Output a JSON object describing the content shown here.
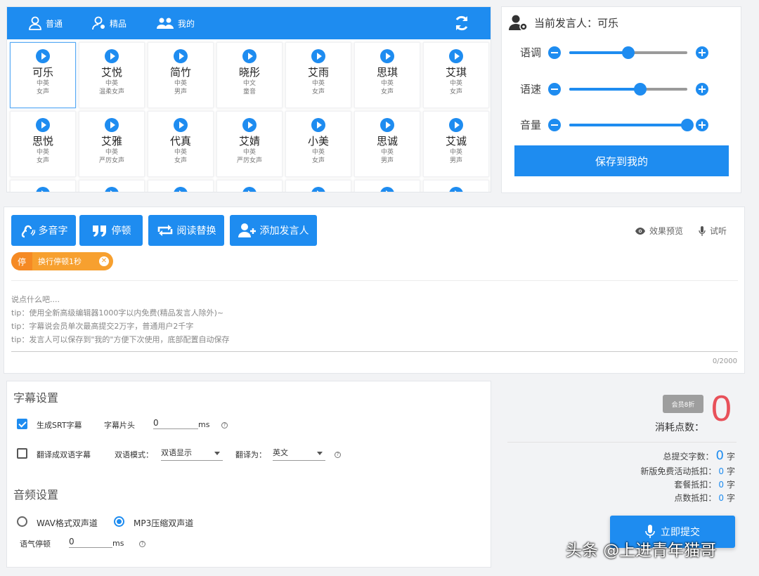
{
  "tabs": [
    {
      "label": "普通",
      "icon": "user-icon"
    },
    {
      "label": "精品",
      "icon": "user-award-icon"
    },
    {
      "label": "我的",
      "icon": "users-group-icon"
    }
  ],
  "voices": [
    {
      "name": "可乐",
      "lang": "中英",
      "type": "女声"
    },
    {
      "name": "艾悦",
      "lang": "中英",
      "type": "温柔女声"
    },
    {
      "name": "简竹",
      "lang": "中英",
      "type": "男声"
    },
    {
      "name": "晓彤",
      "lang": "中文",
      "type": "童音"
    },
    {
      "name": "艾雨",
      "lang": "中英",
      "type": "女声"
    },
    {
      "name": "思琪",
      "lang": "中英",
      "type": "女声"
    },
    {
      "name": "艾琪",
      "lang": "中英",
      "type": "女声"
    },
    {
      "name": "思悦",
      "lang": "中英",
      "type": "女声"
    },
    {
      "name": "艾雅",
      "lang": "中英",
      "type": "严厉女声"
    },
    {
      "name": "代真",
      "lang": "中英",
      "type": "女声"
    },
    {
      "name": "艾婧",
      "lang": "中英",
      "type": "严厉女声"
    },
    {
      "name": "小美",
      "lang": "中英",
      "type": "女声"
    },
    {
      "name": "思诚",
      "lang": "中英",
      "type": "男声"
    },
    {
      "name": "艾诚",
      "lang": "中英",
      "type": "男声"
    }
  ],
  "speaker": {
    "title": "当前发言人：可乐",
    "sliders": [
      {
        "label": "语调",
        "value": 0.5
      },
      {
        "label": "语速",
        "value": 0.6
      },
      {
        "label": "音量",
        "value": 1.0
      }
    ],
    "save_label": "保存到我的"
  },
  "editor": {
    "tools": [
      "多音字",
      "停顿",
      "阅读替换",
      "添加发言人"
    ],
    "preview_label": "效果预览",
    "listen_label": "试听",
    "pause_badge": "停",
    "pause_tag": "换行停顿1秒",
    "placeholder_lines": [
      "说点什么吧....",
      "tip：使用全新高级编辑器1000字以内免费(精品发言人除外)~",
      "tip：字幕说会员单次最高提交2万字，普通用户2千字",
      "tip：发言人可以保存到\"我的\"方便下次使用，底部配置自动保存"
    ],
    "counter": "0/2000"
  },
  "subtitles": {
    "title": "字幕设置",
    "srt_label": "生成SRT字幕",
    "head_label": "字幕片头",
    "head_value": "0",
    "ms": "ms",
    "bilingual_label": "翻译成双语字幕",
    "mode_label": "双语模式：",
    "mode_value": "双语显示",
    "translate_label": "翻译为：",
    "translate_value": "英文",
    "qmark": "?"
  },
  "audio": {
    "title": "音频设置",
    "wav_label": "WAV格式双声道",
    "mp3_label": "MP3压缩双声道",
    "pause_label": "语气停顿",
    "pause_value": "0",
    "ms": "ms"
  },
  "cost": {
    "vip_badge": "会员8折",
    "points": "0",
    "points_label": "消耗点数：",
    "rows": [
      {
        "label": "总提交字数：",
        "value": "0",
        "unit": "字"
      },
      {
        "label": "新版免费活动抵扣：",
        "value": "0",
        "unit": "字"
      },
      {
        "label": "套餐抵扣：",
        "value": "0",
        "unit": "字"
      },
      {
        "label": "点数抵扣：",
        "value": "0",
        "unit": "字"
      }
    ],
    "submit_label": "立即提交"
  },
  "watermark": "头条 @上进青年猫哥",
  "colors": {
    "accent": "#1e8cf0",
    "orange": "#f7a02f",
    "red": "#e8515a"
  }
}
